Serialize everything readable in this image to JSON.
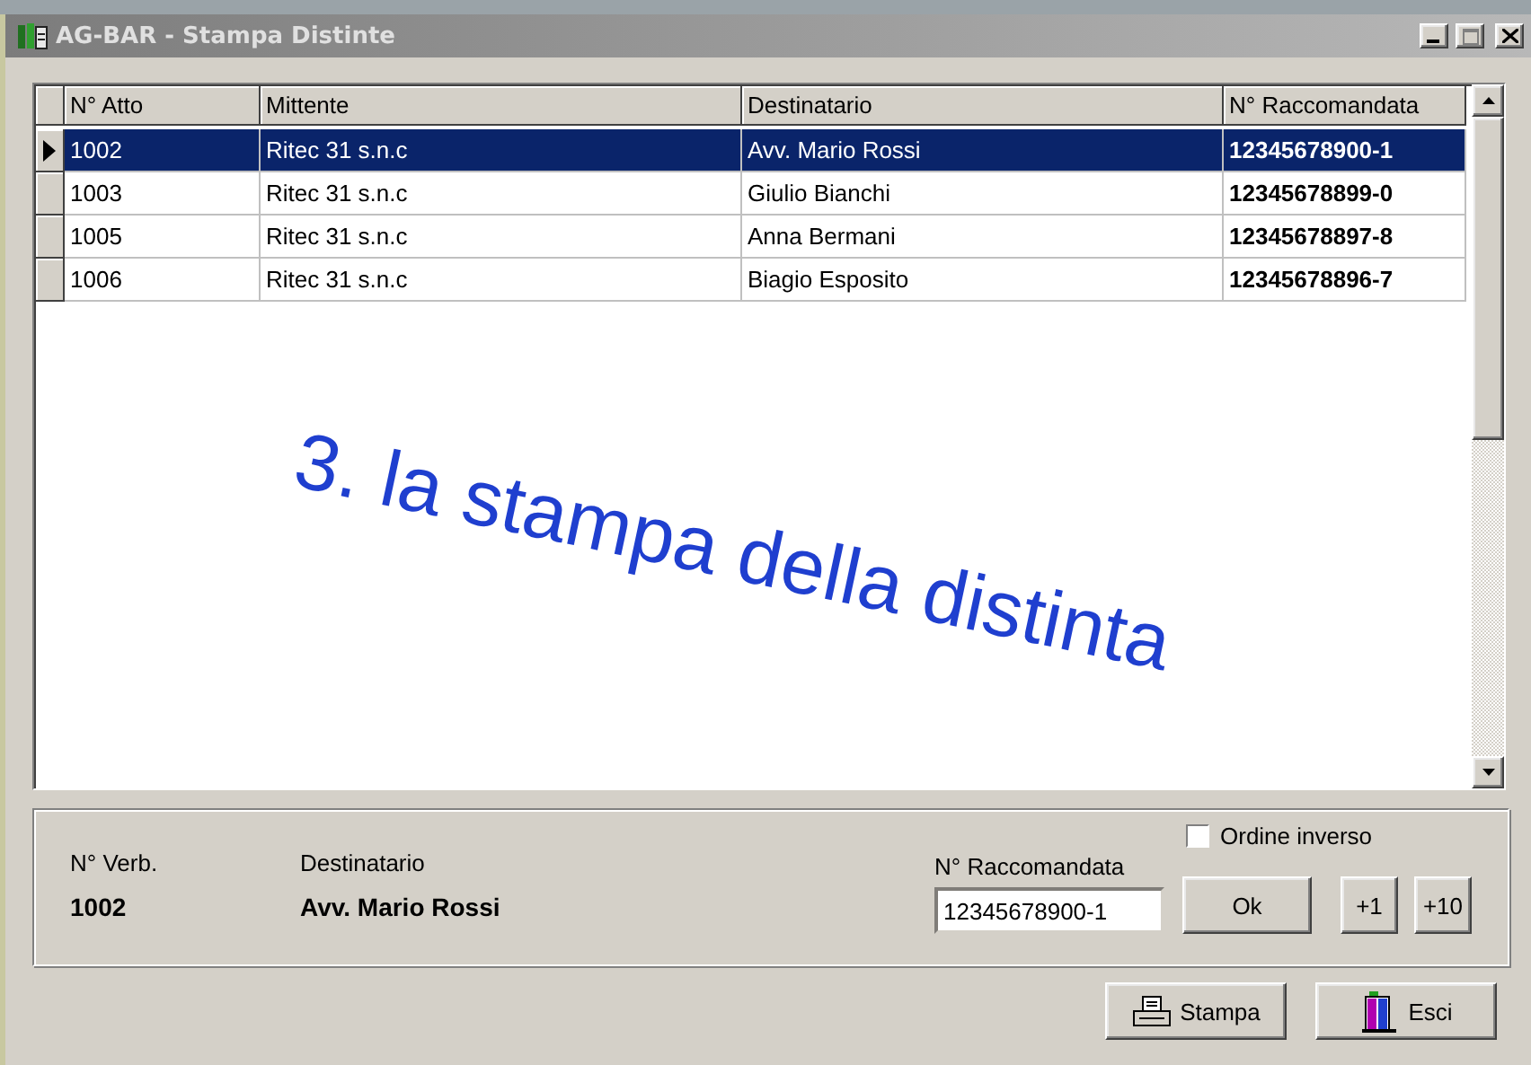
{
  "window": {
    "title": "AG-BAR - Stampa Distinte"
  },
  "table": {
    "columns": [
      "N° Atto",
      "Mittente",
      "Destinatario",
      "N° Raccomandata"
    ],
    "rows": [
      {
        "selected": true,
        "cells": [
          "1002",
          "Ritec 31 s.n.c",
          "Avv. Mario Rossi",
          "12345678900-1"
        ]
      },
      {
        "selected": false,
        "cells": [
          "1003",
          "Ritec 31 s.n.c",
          "Giulio Bianchi",
          "12345678899-0"
        ]
      },
      {
        "selected": false,
        "cells": [
          "1005",
          "Ritec 31 s.n.c",
          "Anna Bermani",
          "12345678897-8"
        ]
      },
      {
        "selected": false,
        "cells": [
          "1006",
          "Ritec 31 s.n.c",
          "Biagio Esposito",
          "12345678896-7"
        ]
      }
    ]
  },
  "annotation": "3. la stampa della distinta",
  "details": {
    "verb_label": "N° Verb.",
    "verb_value": "1002",
    "recipient_label": "Destinatario",
    "recipient_value": "Avv. Mario Rossi",
    "raccomandata_label": "N° Raccomandata",
    "raccomandata_value": "12345678900-1",
    "reverse_order": {
      "label": "Ordine inverso",
      "checked": false
    },
    "buttons": [
      "Ok",
      "+1",
      "+10"
    ]
  },
  "actions": [
    {
      "label": "Stampa",
      "kind": "print"
    },
    {
      "label": "Esci",
      "kind": "exit"
    }
  ]
}
